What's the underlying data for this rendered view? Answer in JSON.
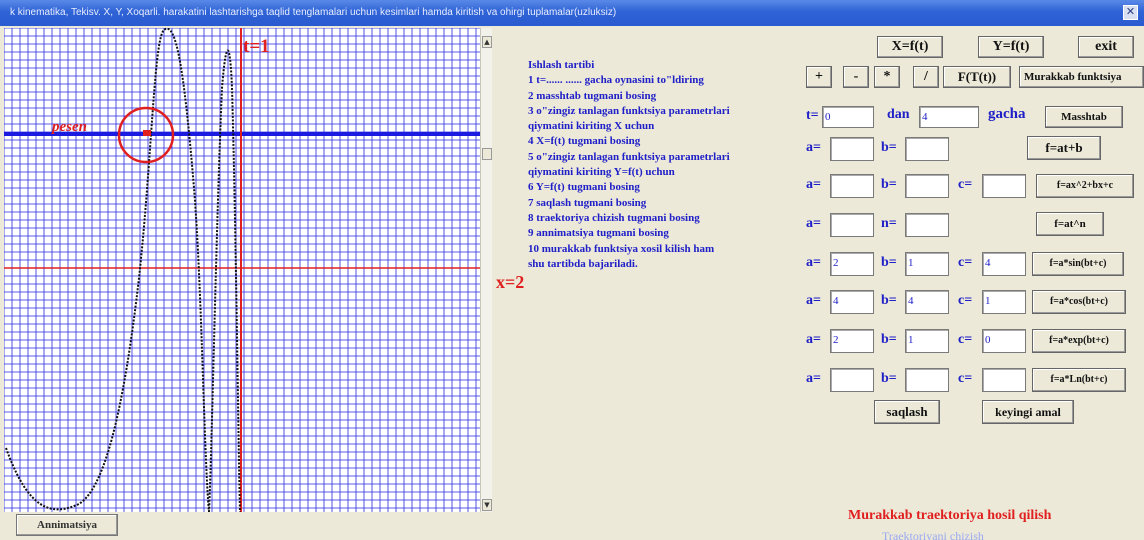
{
  "window": {
    "title": "k kinematika, Tekisv. X, Y, Xoqarli. harakatini lashtarishga taqlid tenglamalari uchun kesimlari hamda kiritish va ohirgi tuplamalar(uzluksiz)",
    "close_glyph": "✕"
  },
  "plot": {
    "t_label": "t=1",
    "reken_label": "pesen",
    "colors": {
      "grid": "#2929e0",
      "axis": "#e02020",
      "hband": "#1a1ae0",
      "curve": "#111111"
    }
  },
  "x_eq_label": "x=2",
  "instructions": {
    "title": "Ishlash tartibi",
    "lines": [
      "1  t=......  ...... gacha  oynasini to\"ldiring",
      "2  masshtab tugmani bosing",
      "3 o\"zingiz tanlagan funktsiya parametrlari",
      "   qiymatini kiriting X uchun",
      "4 X=f(t) tugmani bosing",
      "5 o\"zingiz tanlagan funktsiya parametrlari",
      "   qiymatini kiriting Y=f(t) uchun",
      "6 Y=f(t) tugmani bosing",
      "7  saqlash  tugmani bosing",
      "8 traektoriya chizish  tugmani bosing",
      "9 annimatsiya tugmani bosing",
      "10 murakkab funktsiya xosil kilish ham",
      "    shu tartibda bajariladi."
    ]
  },
  "buttons": {
    "xft": "X=f(t)",
    "yft": "Y=f(t)",
    "exit": "exit",
    "plus": "+",
    "minus": "-",
    "mult": "*",
    "div": "/",
    "ftt": "F(T(t))",
    "murakkab": "Murakkab funktsiya",
    "masshtab": "Masshtab",
    "f_linear": "f=at+b",
    "f_quad": "f=ax^2+bx+c",
    "f_pow": "f=at^n",
    "f_sin": "f=a*sin(bt+c)",
    "f_cos": "f=a*cos(bt+c)",
    "f_exp": "f=a*exp(bt+c)",
    "f_ln": "f=a*Ln(bt+c)",
    "saqlash": "saqlash",
    "keyingi": "keyingi amal",
    "annimatsiya": "Annimatsiya"
  },
  "range": {
    "t_label": "t=",
    "t_value": "0",
    "dan_label": "dan",
    "dan_value": "4",
    "gacha_label": "gacha"
  },
  "params": {
    "linear": {
      "a_label": "a=",
      "a": "",
      "b_label": "b=",
      "b": ""
    },
    "quad": {
      "a_label": "a=",
      "a": "",
      "b_label": "b=",
      "b": "",
      "c_label": "c=",
      "c": ""
    },
    "pow": {
      "a_label": "a=",
      "a": "",
      "n_label": "n=",
      "n": ""
    },
    "sin": {
      "a_label": "a=",
      "a": "2",
      "b_label": "b=",
      "b": "1",
      "c_label": "c=",
      "c": "4"
    },
    "cos": {
      "a_label": "a=",
      "a": "4",
      "b_label": "b=",
      "b": "4",
      "c_label": "c=",
      "c": "1"
    },
    "exp": {
      "a_label": "a=",
      "a": "2",
      "b_label": "b=",
      "b": "1",
      "c_label": "c=",
      "c": "0"
    },
    "ln": {
      "a_label": "a=",
      "a": "",
      "b_label": "b=",
      "b": "",
      "c_label": "c=",
      "c": ""
    }
  },
  "footer": {
    "red": "Murakkab traektoriya  hosil qilish",
    "faded": "Traektoriyani chizish"
  }
}
